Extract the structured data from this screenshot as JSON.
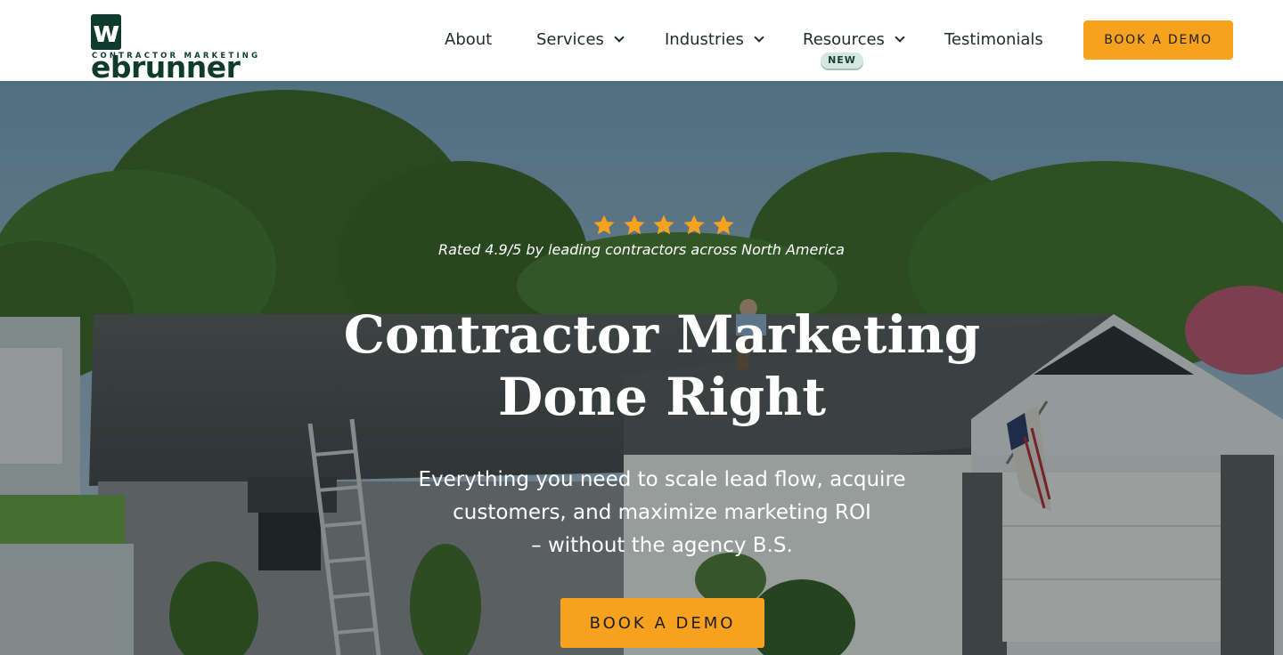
{
  "brand": {
    "logo_first_letter": "w",
    "logo_rest": "ebrunner",
    "logo_tagline": "CONTRACTOR MARKETING",
    "primary_color": "#0f3b2e",
    "accent_color": "#f6a21f"
  },
  "nav": {
    "items": [
      {
        "label": "About",
        "has_dropdown": false
      },
      {
        "label": "Services",
        "has_dropdown": true
      },
      {
        "label": "Industries",
        "has_dropdown": true
      },
      {
        "label": "Resources",
        "has_dropdown": true,
        "badge": "NEW"
      },
      {
        "label": "Testimonials",
        "has_dropdown": false
      }
    ],
    "cta_label": "BOOK A DEMO"
  },
  "hero": {
    "rating_stars": 5,
    "rating_text": "Rated 4.9/5 by leading contractors across North America",
    "title_line1": "Contractor Marketing",
    "title_line2": "Done Right",
    "subtitle_line1": "Everything you need to scale lead flow, acquire",
    "subtitle_line2": "customers, and maximize marketing ROI",
    "subtitle_line3": "– without the agency B.S.",
    "cta_label": "BOOK A DEMO",
    "star_color": "#f6a21f"
  }
}
